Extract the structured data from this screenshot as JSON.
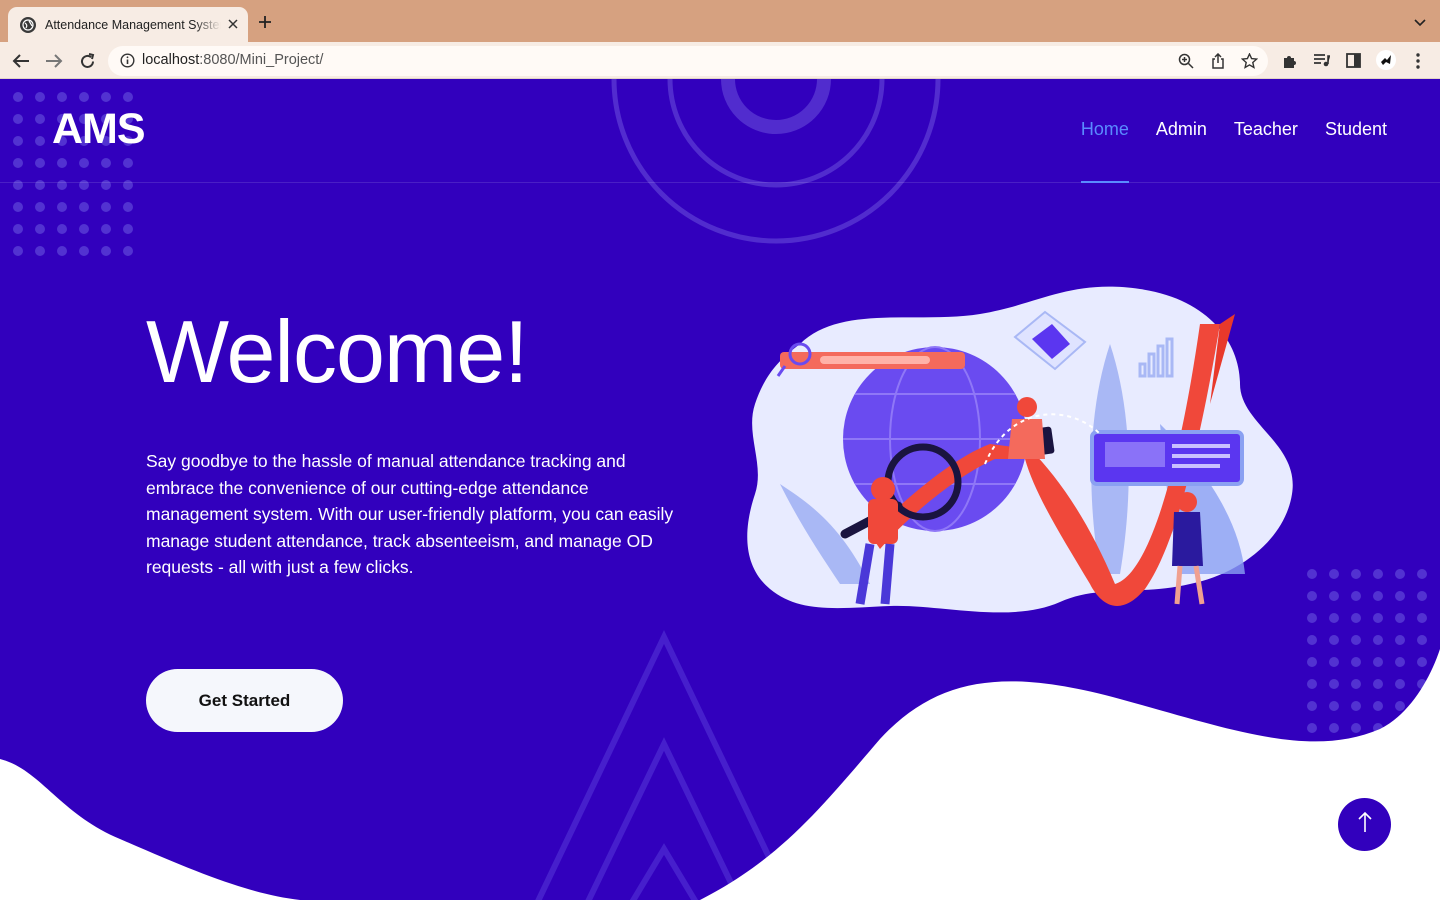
{
  "browser": {
    "tab_title": "Attendance Management System",
    "url_host": "localhost",
    "url_path": ":8080/Mini_Project/"
  },
  "site": {
    "logo": "AMS",
    "nav": [
      {
        "label": "Home",
        "active": true
      },
      {
        "label": "Admin",
        "active": false
      },
      {
        "label": "Teacher",
        "active": false
      },
      {
        "label": "Student",
        "active": false
      }
    ]
  },
  "hero": {
    "title": "Welcome!",
    "text": "Say goodbye to the hassle of manual attendance tracking and embrace the convenience of our cutting-edge attendance management system. With our user-friendly platform, you can easily manage student attendance, track absenteeism, and manage OD requests - all with just a few clicks.",
    "cta_label": "Get Started"
  },
  "colors": {
    "primary": "#3200bd",
    "nav_active": "#5a8bff",
    "chrome": "#d6a180",
    "accent_red": "#f0483a"
  },
  "icons": [
    "globe-icon",
    "close-icon",
    "plus-icon",
    "chevron-down-icon",
    "back-arrow-icon",
    "forward-arrow-icon",
    "reload-icon",
    "info-icon",
    "zoom-icon",
    "share-icon",
    "star-icon",
    "puzzle-icon",
    "media-icon",
    "sidepanel-icon",
    "arrow-up-icon"
  ]
}
